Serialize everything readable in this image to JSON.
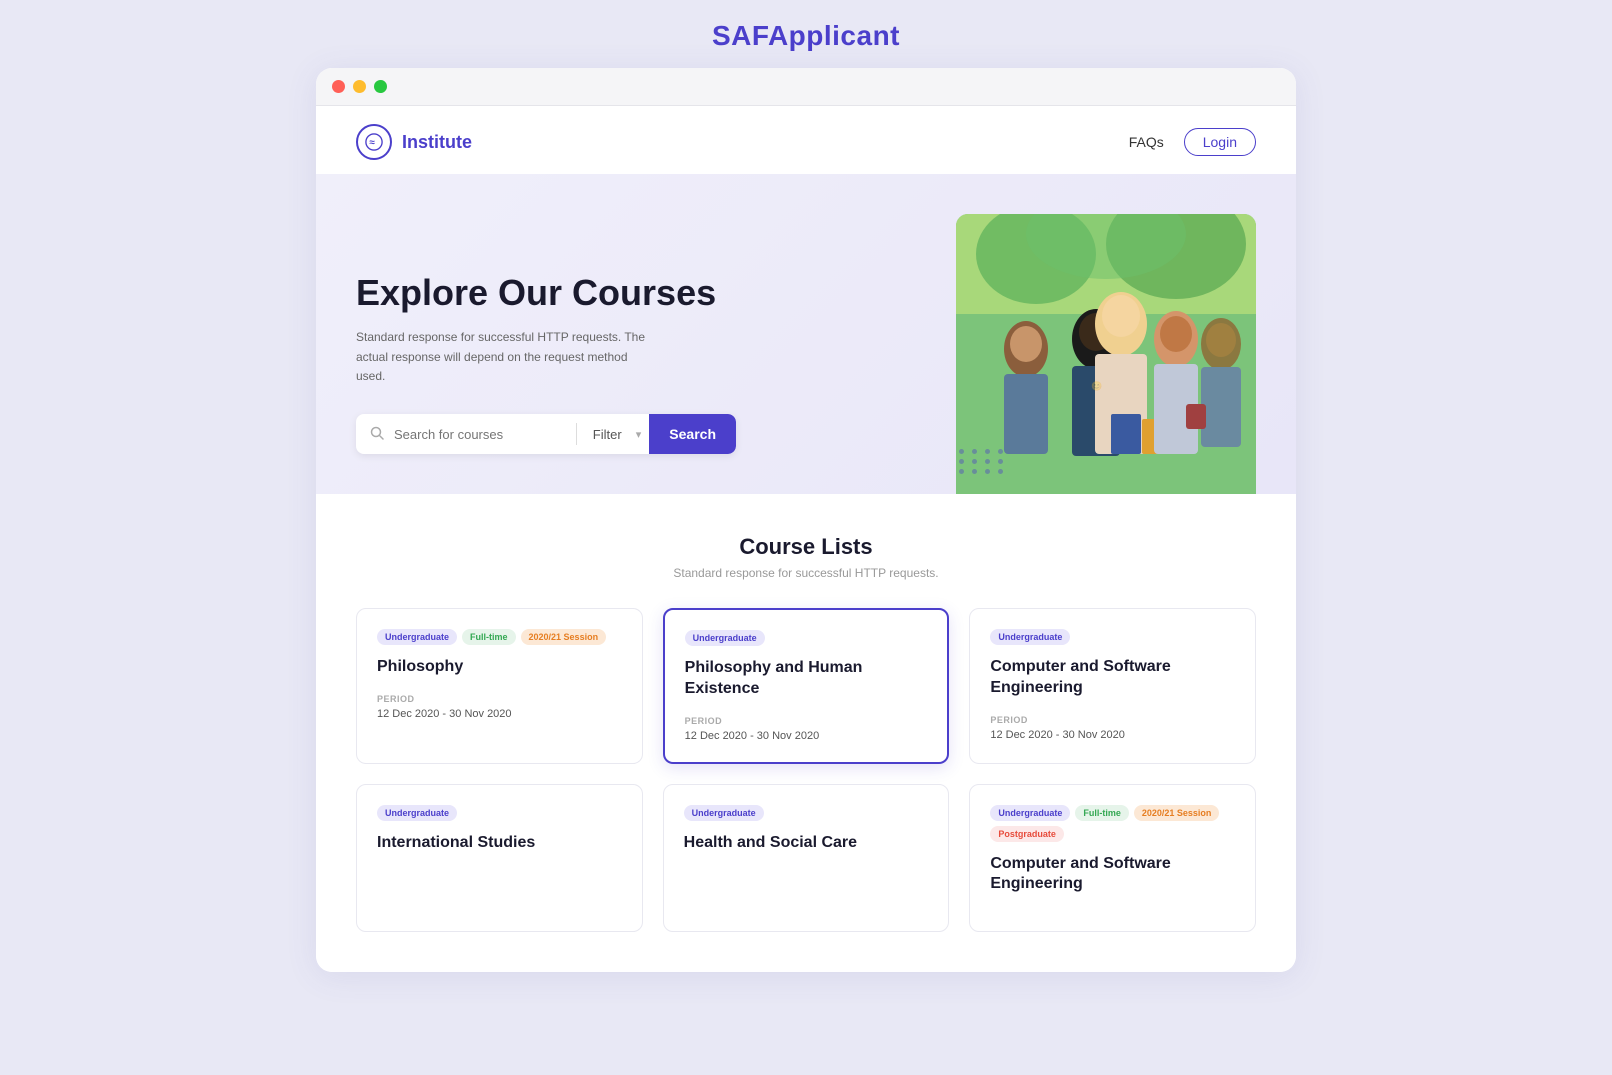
{
  "appTitle": "SAFApplicant",
  "navbar": {
    "brand": "Institute",
    "brandIcon": "≡",
    "faqsLabel": "FAQs",
    "loginLabel": "Login"
  },
  "hero": {
    "title": "Explore Our Courses",
    "subtitle": "Standard response for successful HTTP requests. The actual response will depend on the request method used.",
    "searchPlaceholder": "Search for courses",
    "filterLabel": "Filter",
    "searchButtonLabel": "Search"
  },
  "courseSection": {
    "title": "Course Lists",
    "subtitle": "Standard response for successful HTTP requests.",
    "courses": [
      {
        "id": 1,
        "tags": [
          {
            "label": "Undergraduate",
            "type": "undergraduate"
          },
          {
            "label": "Full-time",
            "type": "fulltime"
          },
          {
            "label": "2020/21 Session",
            "type": "session"
          }
        ],
        "title": "Philosophy",
        "periodLabel": "PERIOD",
        "period": "12 Dec 2020 - 30 Nov 2020",
        "active": false
      },
      {
        "id": 2,
        "tags": [
          {
            "label": "Undergraduate",
            "type": "undergraduate"
          }
        ],
        "title": "Philosophy and Human Existence",
        "periodLabel": "PERIOD",
        "period": "12 Dec 2020 - 30 Nov 2020",
        "active": true
      },
      {
        "id": 3,
        "tags": [
          {
            "label": "Undergraduate",
            "type": "undergraduate"
          }
        ],
        "title": "Computer and Software Engineering",
        "periodLabel": "PERIOD",
        "period": "12 Dec 2020 - 30 Nov 2020",
        "active": false
      },
      {
        "id": 4,
        "tags": [
          {
            "label": "Undergraduate",
            "type": "undergraduate"
          }
        ],
        "title": "International Studies",
        "periodLabel": "",
        "period": "",
        "active": false
      },
      {
        "id": 5,
        "tags": [
          {
            "label": "Undergraduate",
            "type": "undergraduate"
          }
        ],
        "title": "Health and Social Care",
        "periodLabel": "",
        "period": "",
        "active": false
      },
      {
        "id": 6,
        "tags": [
          {
            "label": "Undergraduate",
            "type": "undergraduate"
          },
          {
            "label": "Full-time",
            "type": "fulltime"
          },
          {
            "label": "2020/21 Session",
            "type": "session"
          },
          {
            "label": "Postgraduate",
            "type": "postgraduate"
          }
        ],
        "title": "Computer and Software Engineering",
        "periodLabel": "",
        "period": "",
        "active": false
      }
    ]
  }
}
